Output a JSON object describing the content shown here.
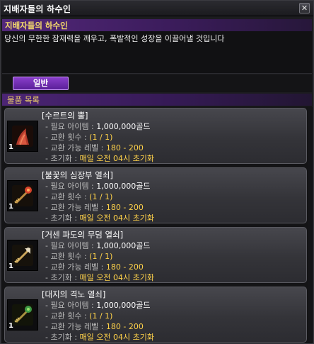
{
  "window": {
    "title": "지배자들의 하수인",
    "close_glyph": "✕"
  },
  "npc": {
    "name": "지배자들의 하수인",
    "description": "당신의 무한한 잠재력을 깨우고, 폭발적인 성장을 이끌어낼 것입니다"
  },
  "tabs": [
    {
      "label": "일반",
      "selected": true
    }
  ],
  "section": {
    "title": "물품 목록"
  },
  "colors": {
    "accent_yellow": "#ffd24a",
    "header_purple": "#53287b",
    "tab_purple": "#8a3fcb"
  },
  "items": [
    {
      "name": "[수르트의 뿔]",
      "icon": "red-horn-icon",
      "qty": "1",
      "rows": [
        {
          "key": "- 필요 아이템 : ",
          "value": "1,000,000골드",
          "style": "v"
        },
        {
          "key": "- 교환 횟수 : ",
          "value": "(1 / 1)",
          "style": "vy"
        },
        {
          "key": "- 교환 가능 레벨 : ",
          "value": "180 - 200",
          "style": "v"
        },
        {
          "key": "- 초기화 : ",
          "value": "매일 오전 04시 초기화",
          "style": "vy"
        }
      ]
    },
    {
      "name": "[불꽃의 심장부 열쇠]",
      "icon": "fire-key-icon",
      "qty": "1",
      "rows": [
        {
          "key": "- 필요 아이템 : ",
          "value": "1,000,000골드",
          "style": "v"
        },
        {
          "key": "- 교환 횟수 : ",
          "value": "(1 / 1)",
          "style": "vy"
        },
        {
          "key": "- 교환 가능 레벨 : ",
          "value": "180 - 200",
          "style": "v"
        },
        {
          "key": "- 초기화 : ",
          "value": "매일 오전 04시 초기화",
          "style": "vy"
        }
      ]
    },
    {
      "name": "[거센 파도의 무덤 열쇠]",
      "icon": "wave-key-icon",
      "qty": "1",
      "rows": [
        {
          "key": "- 필요 아이템 : ",
          "value": "1,000,000골드",
          "style": "v"
        },
        {
          "key": "- 교환 횟수 : ",
          "value": "(1 / 1)",
          "style": "vy"
        },
        {
          "key": "- 교환 가능 레벨 : ",
          "value": "180 - 200",
          "style": "v"
        },
        {
          "key": "- 초기화 : ",
          "value": "매일 오전 04시 초기화",
          "style": "vy"
        }
      ]
    },
    {
      "name": "[대지의 격노 열쇠]",
      "icon": "earth-key-icon",
      "qty": "1",
      "rows": [
        {
          "key": "- 필요 아이템 : ",
          "value": "1,000,000골드",
          "style": "v"
        },
        {
          "key": "- 교환 횟수 : ",
          "value": "(1 / 1)",
          "style": "vy"
        },
        {
          "key": "- 교환 가능 레벨 : ",
          "value": "180 - 200",
          "style": "v"
        },
        {
          "key": "- 초기화 : ",
          "value": "매일 오전 04시 초기화",
          "style": "vy"
        }
      ]
    }
  ]
}
